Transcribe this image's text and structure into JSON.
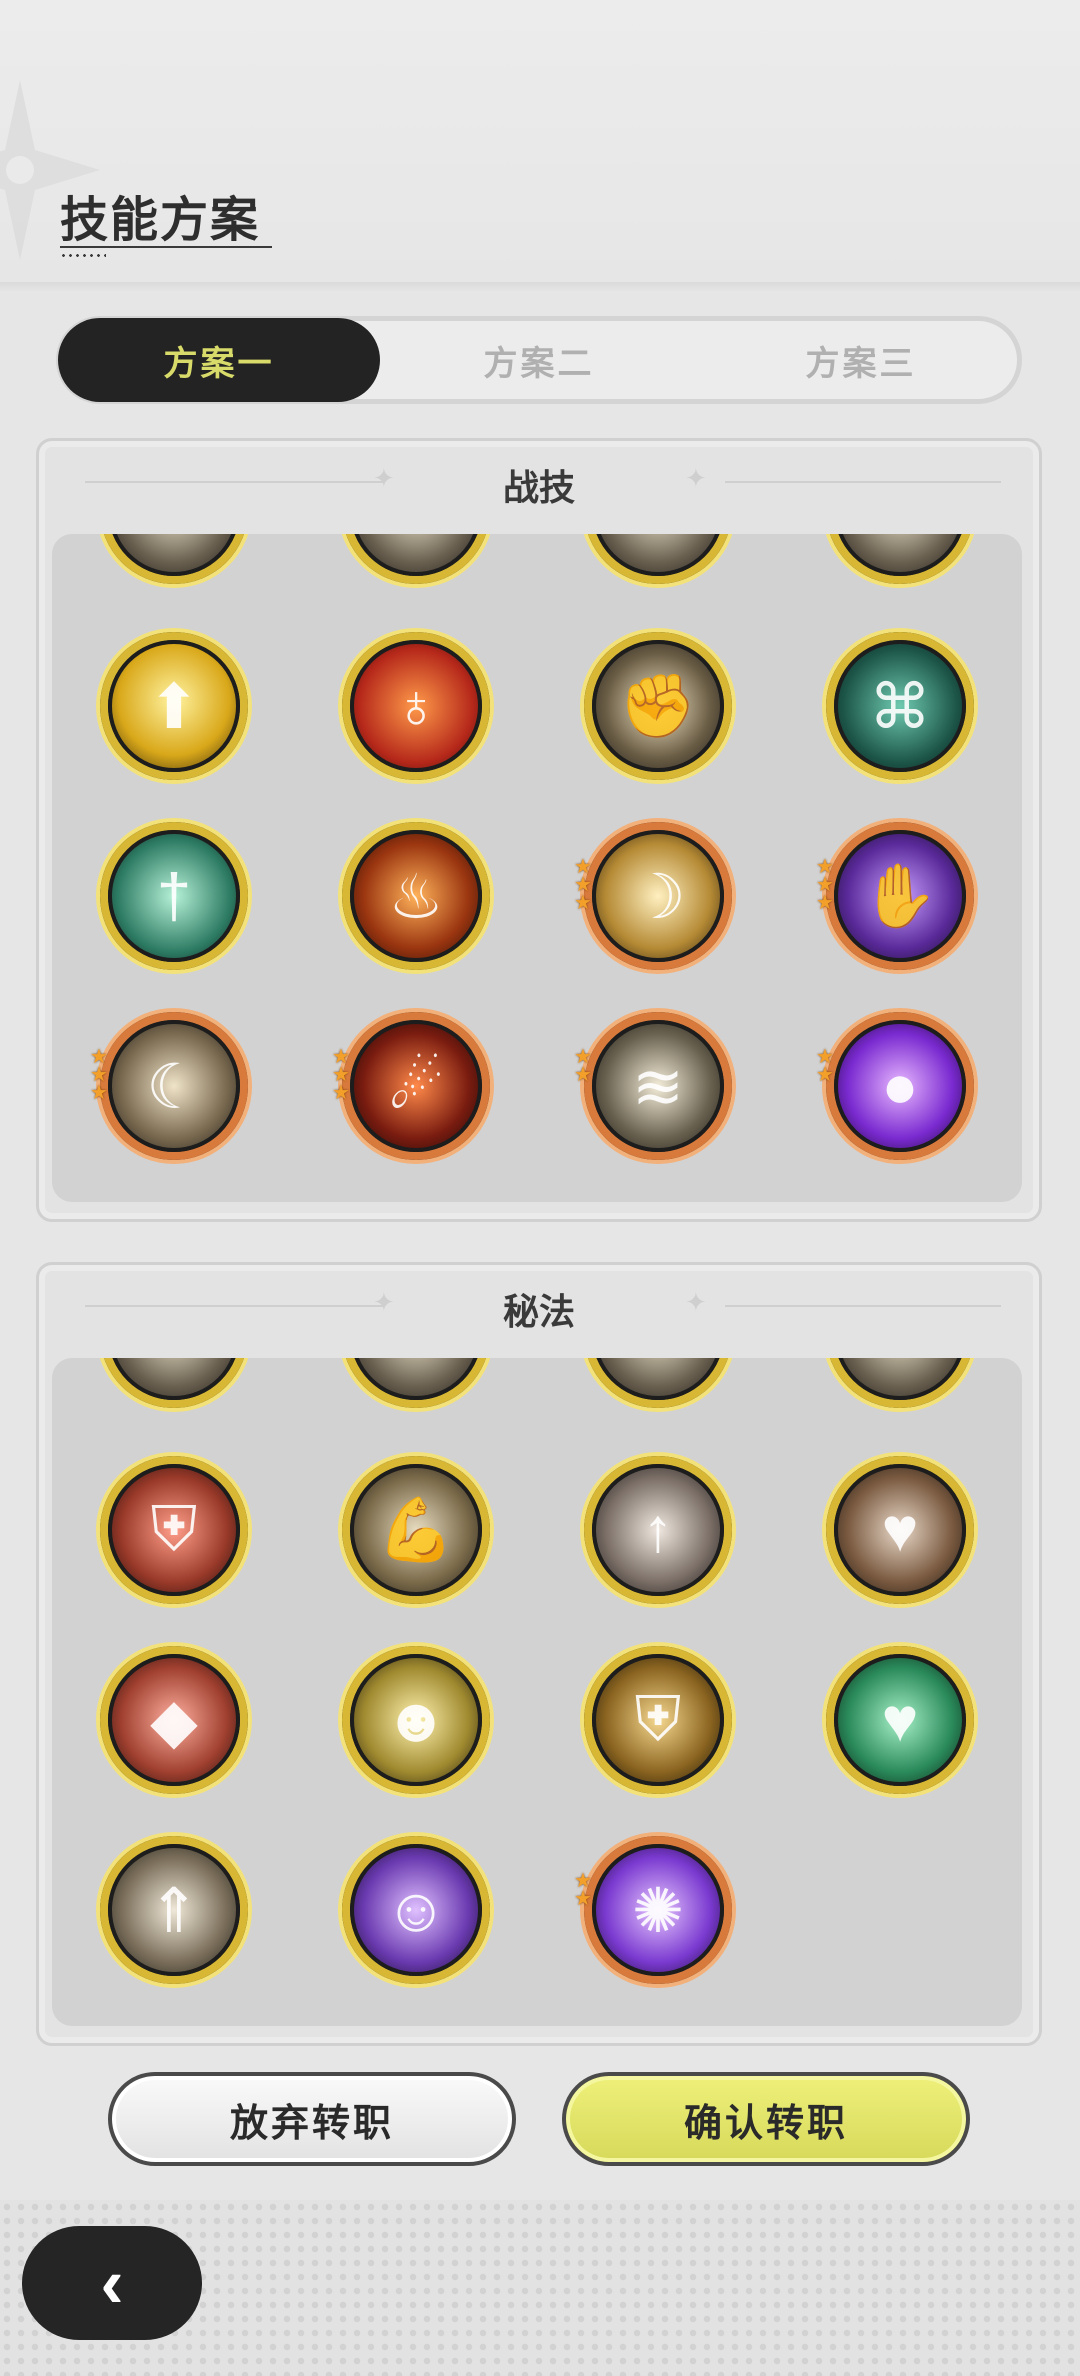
{
  "header": {
    "title": "技能方案"
  },
  "tabs": [
    {
      "label": "方案一",
      "active": true
    },
    {
      "label": "方案二",
      "active": false
    },
    {
      "label": "方案三",
      "active": false
    }
  ],
  "combat_section": {
    "title": "战技",
    "partial_row_icons": [
      "partial-skill-icon",
      "partial-skill-icon",
      "partial-skill-icon",
      "partial-skill-icon"
    ],
    "rows": [
      [
        {
          "icon": "golden-shield-buff-icon",
          "rarity": "gold",
          "stars": 0
        },
        {
          "icon": "fire-emblem-icon",
          "rarity": "gold",
          "stars": 0
        },
        {
          "icon": "strike-impact-icon",
          "rarity": "gold",
          "stars": 0
        },
        {
          "icon": "spider-web-icon",
          "rarity": "gold",
          "stars": 0
        }
      ],
      [
        {
          "icon": "sword-burst-icon",
          "rarity": "gold",
          "stars": 0
        },
        {
          "icon": "flame-circle-icon",
          "rarity": "gold",
          "stars": 0
        },
        {
          "icon": "golden-slash-icon",
          "rarity": "orange",
          "stars": 3
        },
        {
          "icon": "purple-claw-icon",
          "rarity": "orange",
          "stars": 3
        }
      ],
      [
        {
          "icon": "thorn-sword-icon",
          "rarity": "orange",
          "stars": 3
        },
        {
          "icon": "red-crescent-slash-icon",
          "rarity": "orange",
          "stars": 3
        },
        {
          "icon": "wind-slash-icon",
          "rarity": "orange",
          "stars": 2
        },
        {
          "icon": "purple-flame-orb-icon",
          "rarity": "orange",
          "stars": 2
        }
      ]
    ]
  },
  "secret_section": {
    "title": "秘法",
    "partial_row_icons": [
      "partial-skill-icon",
      "partial-skill-icon",
      "partial-skill-icon",
      "partial-skill-icon"
    ],
    "rows": [
      [
        {
          "icon": "red-armor-icon",
          "rarity": "gold",
          "stars": 0
        },
        {
          "icon": "flexed-arm-icon",
          "rarity": "gold",
          "stars": 0
        },
        {
          "icon": "sword-up-icon",
          "rarity": "gold",
          "stars": 0
        },
        {
          "icon": "heart-shield-icon",
          "rarity": "gold",
          "stars": 0
        }
      ],
      [
        {
          "icon": "red-crystal-icon",
          "rarity": "gold",
          "stars": 0
        },
        {
          "icon": "glowing-figure-icon",
          "rarity": "gold",
          "stars": 0
        },
        {
          "icon": "golden-armor-icon",
          "rarity": "gold",
          "stars": 0
        },
        {
          "icon": "green-heart-icon",
          "rarity": "gold",
          "stars": 0
        }
      ],
      [
        {
          "icon": "sword-boost-icon",
          "rarity": "gold",
          "stars": 0
        },
        {
          "icon": "purple-figure-icon",
          "rarity": "gold",
          "stars": 0
        },
        {
          "icon": "purple-orb-icon",
          "rarity": "orange",
          "stars": 2
        }
      ]
    ]
  },
  "buttons": {
    "abandon_label": "放弃转职",
    "confirm_label": "确认转职"
  },
  "back_button": {
    "glyph": "‹"
  },
  "colors": {
    "tab_active_bg": "#232323",
    "tab_active_text": "#d8db6a",
    "confirm_button": "#e2e46a",
    "gold_ring": "#d7b733",
    "orange_ring": "#d87a3c"
  }
}
